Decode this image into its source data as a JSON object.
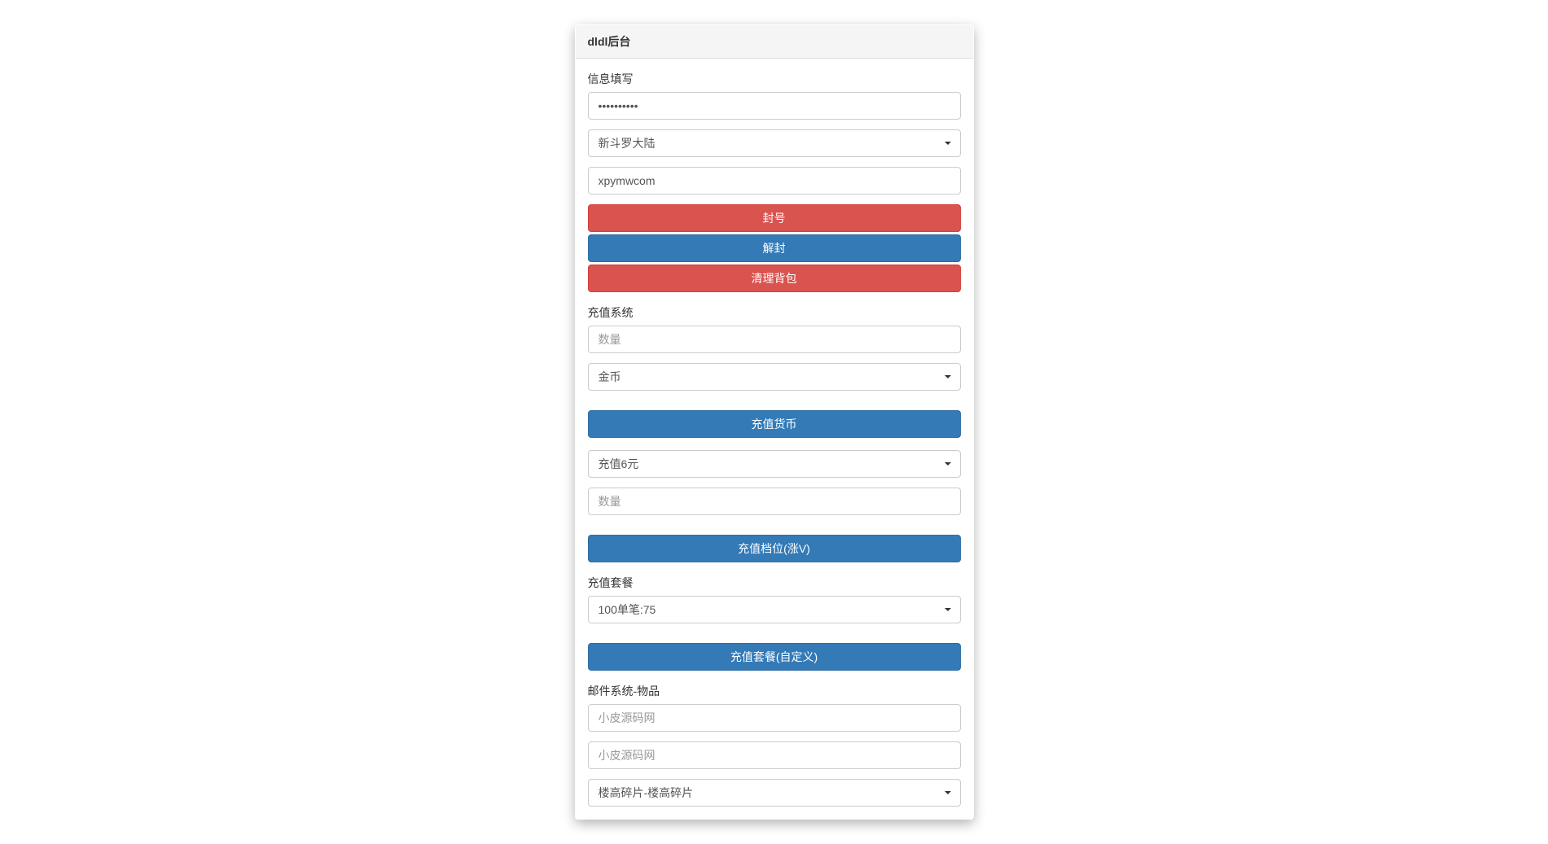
{
  "panel": {
    "title": "dldl后台"
  },
  "info_section": {
    "label": "信息填写",
    "password_value": "••••••••••",
    "server_select": "新斗罗大陆",
    "account_value": "xpymwcom"
  },
  "account_buttons": {
    "ban": "封号",
    "unban": "解封",
    "clear_bag": "清理背包"
  },
  "recharge_section": {
    "label": "充值系统",
    "qty_placeholder": "数量",
    "currency_select": "金币",
    "recharge_currency_btn": "充值货币",
    "tier_select": "充值6元",
    "tier_qty_placeholder": "数量",
    "recharge_tier_btn": "充值档位(涨V)"
  },
  "package_section": {
    "label": "充值套餐",
    "package_select": "100单笔:75",
    "package_btn": "充值套餐(自定义)"
  },
  "mail_section": {
    "label": "邮件系统-物品",
    "field1_placeholder": "小皮源码网",
    "field2_placeholder": "小皮源码网",
    "item_select": "楼高碎片-楼高碎片"
  }
}
